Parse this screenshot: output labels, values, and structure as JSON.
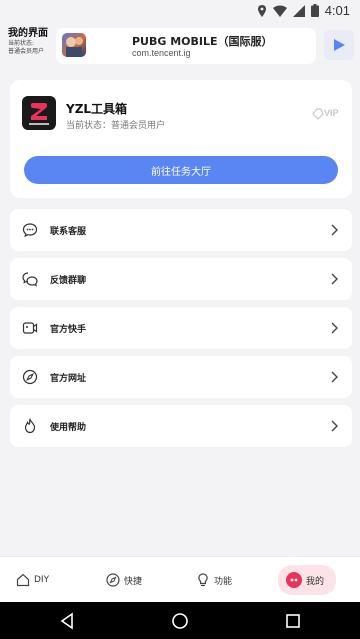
{
  "status_bar": {
    "time": "4:01"
  },
  "header": {
    "brand_title": "我的界面",
    "brand_status_label": "当前状态:",
    "brand_status_value": "普通会员用户",
    "game_name": "PUBG MOBILE（国际服）",
    "game_package": "com.tencent.ig"
  },
  "account": {
    "app_name": "YZL工具箱",
    "status_text": "当前状态：普通会员用户",
    "vip_label": "VIP",
    "cta_label": "前往任务大厅"
  },
  "menu": [
    {
      "label": "联系客服",
      "icon": "chat-bubble-icon"
    },
    {
      "label": "反馈群聊",
      "icon": "group-chat-icon"
    },
    {
      "label": "官方快手",
      "icon": "video-icon"
    },
    {
      "label": "官方网址",
      "icon": "compass-icon"
    },
    {
      "label": "使用帮助",
      "icon": "flame-help-icon"
    }
  ],
  "bottom_nav": [
    {
      "label": "DIY",
      "icon": "home-icon"
    },
    {
      "label": "快捷",
      "icon": "compass-icon"
    },
    {
      "label": "功能",
      "icon": "bulb-icon"
    },
    {
      "label": "我的",
      "icon": "profile-dot-icon"
    }
  ],
  "colors": {
    "accent": "#5a86f4",
    "profile_dot": "#e8335a",
    "background": "#f3f3f5"
  }
}
